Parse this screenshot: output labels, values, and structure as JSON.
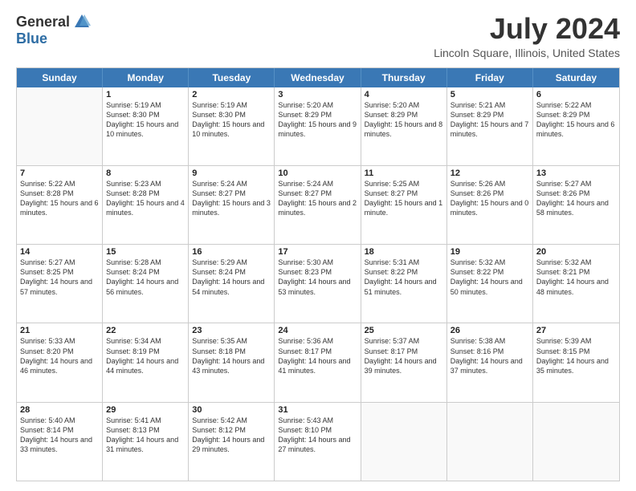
{
  "logo": {
    "general": "General",
    "blue": "Blue"
  },
  "title": "July 2024",
  "location": "Lincoln Square, Illinois, United States",
  "days_header": [
    "Sunday",
    "Monday",
    "Tuesday",
    "Wednesday",
    "Thursday",
    "Friday",
    "Saturday"
  ],
  "weeks": [
    [
      {
        "day": "",
        "sunrise": "",
        "sunset": "",
        "daylight": "",
        "empty": true
      },
      {
        "day": "1",
        "sunrise": "Sunrise: 5:19 AM",
        "sunset": "Sunset: 8:30 PM",
        "daylight": "Daylight: 15 hours and 10 minutes."
      },
      {
        "day": "2",
        "sunrise": "Sunrise: 5:19 AM",
        "sunset": "Sunset: 8:30 PM",
        "daylight": "Daylight: 15 hours and 10 minutes."
      },
      {
        "day": "3",
        "sunrise": "Sunrise: 5:20 AM",
        "sunset": "Sunset: 8:29 PM",
        "daylight": "Daylight: 15 hours and 9 minutes."
      },
      {
        "day": "4",
        "sunrise": "Sunrise: 5:20 AM",
        "sunset": "Sunset: 8:29 PM",
        "daylight": "Daylight: 15 hours and 8 minutes."
      },
      {
        "day": "5",
        "sunrise": "Sunrise: 5:21 AM",
        "sunset": "Sunset: 8:29 PM",
        "daylight": "Daylight: 15 hours and 7 minutes."
      },
      {
        "day": "6",
        "sunrise": "Sunrise: 5:22 AM",
        "sunset": "Sunset: 8:29 PM",
        "daylight": "Daylight: 15 hours and 6 minutes."
      }
    ],
    [
      {
        "day": "7",
        "sunrise": "Sunrise: 5:22 AM",
        "sunset": "Sunset: 8:28 PM",
        "daylight": "Daylight: 15 hours and 6 minutes."
      },
      {
        "day": "8",
        "sunrise": "Sunrise: 5:23 AM",
        "sunset": "Sunset: 8:28 PM",
        "daylight": "Daylight: 15 hours and 4 minutes."
      },
      {
        "day": "9",
        "sunrise": "Sunrise: 5:24 AM",
        "sunset": "Sunset: 8:27 PM",
        "daylight": "Daylight: 15 hours and 3 minutes."
      },
      {
        "day": "10",
        "sunrise": "Sunrise: 5:24 AM",
        "sunset": "Sunset: 8:27 PM",
        "daylight": "Daylight: 15 hours and 2 minutes."
      },
      {
        "day": "11",
        "sunrise": "Sunrise: 5:25 AM",
        "sunset": "Sunset: 8:27 PM",
        "daylight": "Daylight: 15 hours and 1 minute."
      },
      {
        "day": "12",
        "sunrise": "Sunrise: 5:26 AM",
        "sunset": "Sunset: 8:26 PM",
        "daylight": "Daylight: 15 hours and 0 minutes."
      },
      {
        "day": "13",
        "sunrise": "Sunrise: 5:27 AM",
        "sunset": "Sunset: 8:26 PM",
        "daylight": "Daylight: 14 hours and 58 minutes."
      }
    ],
    [
      {
        "day": "14",
        "sunrise": "Sunrise: 5:27 AM",
        "sunset": "Sunset: 8:25 PM",
        "daylight": "Daylight: 14 hours and 57 minutes."
      },
      {
        "day": "15",
        "sunrise": "Sunrise: 5:28 AM",
        "sunset": "Sunset: 8:24 PM",
        "daylight": "Daylight: 14 hours and 56 minutes."
      },
      {
        "day": "16",
        "sunrise": "Sunrise: 5:29 AM",
        "sunset": "Sunset: 8:24 PM",
        "daylight": "Daylight: 14 hours and 54 minutes."
      },
      {
        "day": "17",
        "sunrise": "Sunrise: 5:30 AM",
        "sunset": "Sunset: 8:23 PM",
        "daylight": "Daylight: 14 hours and 53 minutes."
      },
      {
        "day": "18",
        "sunrise": "Sunrise: 5:31 AM",
        "sunset": "Sunset: 8:22 PM",
        "daylight": "Daylight: 14 hours and 51 minutes."
      },
      {
        "day": "19",
        "sunrise": "Sunrise: 5:32 AM",
        "sunset": "Sunset: 8:22 PM",
        "daylight": "Daylight: 14 hours and 50 minutes."
      },
      {
        "day": "20",
        "sunrise": "Sunrise: 5:32 AM",
        "sunset": "Sunset: 8:21 PM",
        "daylight": "Daylight: 14 hours and 48 minutes."
      }
    ],
    [
      {
        "day": "21",
        "sunrise": "Sunrise: 5:33 AM",
        "sunset": "Sunset: 8:20 PM",
        "daylight": "Daylight: 14 hours and 46 minutes."
      },
      {
        "day": "22",
        "sunrise": "Sunrise: 5:34 AM",
        "sunset": "Sunset: 8:19 PM",
        "daylight": "Daylight: 14 hours and 44 minutes."
      },
      {
        "day": "23",
        "sunrise": "Sunrise: 5:35 AM",
        "sunset": "Sunset: 8:18 PM",
        "daylight": "Daylight: 14 hours and 43 minutes."
      },
      {
        "day": "24",
        "sunrise": "Sunrise: 5:36 AM",
        "sunset": "Sunset: 8:17 PM",
        "daylight": "Daylight: 14 hours and 41 minutes."
      },
      {
        "day": "25",
        "sunrise": "Sunrise: 5:37 AM",
        "sunset": "Sunset: 8:17 PM",
        "daylight": "Daylight: 14 hours and 39 minutes."
      },
      {
        "day": "26",
        "sunrise": "Sunrise: 5:38 AM",
        "sunset": "Sunset: 8:16 PM",
        "daylight": "Daylight: 14 hours and 37 minutes."
      },
      {
        "day": "27",
        "sunrise": "Sunrise: 5:39 AM",
        "sunset": "Sunset: 8:15 PM",
        "daylight": "Daylight: 14 hours and 35 minutes."
      }
    ],
    [
      {
        "day": "28",
        "sunrise": "Sunrise: 5:40 AM",
        "sunset": "Sunset: 8:14 PM",
        "daylight": "Daylight: 14 hours and 33 minutes."
      },
      {
        "day": "29",
        "sunrise": "Sunrise: 5:41 AM",
        "sunset": "Sunset: 8:13 PM",
        "daylight": "Daylight: 14 hours and 31 minutes."
      },
      {
        "day": "30",
        "sunrise": "Sunrise: 5:42 AM",
        "sunset": "Sunset: 8:12 PM",
        "daylight": "Daylight: 14 hours and 29 minutes."
      },
      {
        "day": "31",
        "sunrise": "Sunrise: 5:43 AM",
        "sunset": "Sunset: 8:10 PM",
        "daylight": "Daylight: 14 hours and 27 minutes."
      },
      {
        "day": "",
        "sunrise": "",
        "sunset": "",
        "daylight": "",
        "empty": true
      },
      {
        "day": "",
        "sunrise": "",
        "sunset": "",
        "daylight": "",
        "empty": true
      },
      {
        "day": "",
        "sunrise": "",
        "sunset": "",
        "daylight": "",
        "empty": true
      }
    ]
  ]
}
